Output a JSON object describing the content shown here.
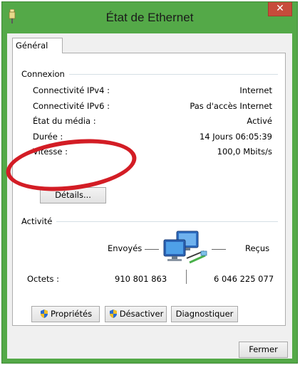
{
  "window": {
    "title": "État de Ethernet",
    "close_glyph": "✕",
    "colors": {
      "frame": "#54a948",
      "close": "#c74b3b",
      "annotation": "#d31d25"
    }
  },
  "tabs": [
    {
      "label": "Général"
    }
  ],
  "connexion": {
    "heading": "Connexion",
    "rows": [
      {
        "label": "Connectivité IPv4 :",
        "value": "Internet"
      },
      {
        "label": "Connectivité IPv6 :",
        "value": "Pas d'accès Internet"
      },
      {
        "label": "État du média :",
        "value": "Activé"
      },
      {
        "label": "Durée :",
        "value": "14 Jours 06:05:39"
      },
      {
        "label": "Vitesse :",
        "value": "100,0 Mbits/s"
      }
    ],
    "details_button": "Détails..."
  },
  "activite": {
    "heading": "Activité",
    "sent_label": "Envoyés",
    "received_label": "Reçus",
    "bytes_label": "Octets :",
    "bytes_sent": "910 801 863",
    "bytes_received": "6 046 225 077",
    "icon": "network-computers-icon"
  },
  "buttons": {
    "properties": "Propriétés",
    "disable": "Désactiver",
    "diagnose": "Diagnostiquer",
    "close": "Fermer"
  }
}
